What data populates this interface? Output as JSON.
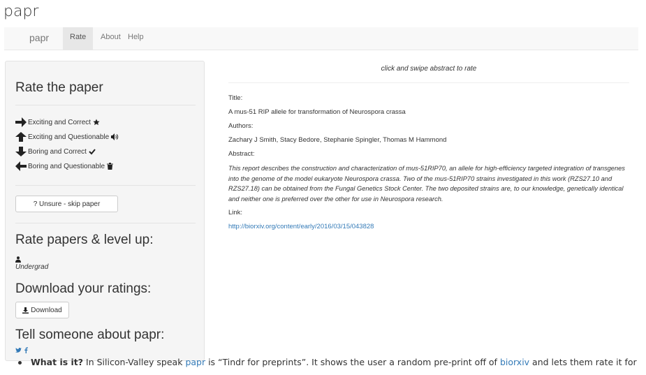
{
  "page": {
    "title": "papr"
  },
  "navbar": {
    "brand": "papr",
    "items": [
      {
        "label": "Rate",
        "active": true
      },
      {
        "label": "About",
        "active": false
      },
      {
        "label": "Help",
        "active": false
      }
    ]
  },
  "sidebar": {
    "heading_rate": "Rate the paper",
    "rate_options": [
      {
        "direction": "right",
        "label": "Exciting and Correct",
        "icon": "star-icon"
      },
      {
        "direction": "up",
        "label": "Exciting and Questionable",
        "icon": "volume-icon"
      },
      {
        "direction": "down",
        "label": "Boring and Correct",
        "icon": "check-icon"
      },
      {
        "direction": "left",
        "label": "Boring and Questionable",
        "icon": "trash-icon"
      }
    ],
    "skip_button": "? Unsure - skip paper",
    "heading_level": "Rate papers & level up:",
    "level_name": "Undergrad",
    "heading_download": "Download your ratings:",
    "download_button": "Download",
    "heading_share": "Tell someone about papr:",
    "share_icons": [
      "twitter-icon",
      "facebook-icon"
    ]
  },
  "main": {
    "instruction": "click and swipe abstract to rate",
    "title_label": "Title:",
    "title": "A mus-51 RIP allele for transformation of Neurospora crassa",
    "authors_label": "Authors:",
    "authors": "Zachary J Smith, Stacy Bedore, Stephanie Spingler, Thomas M Hammond",
    "abstract_label": "Abstract:",
    "abstract": "This report describes the construction and characterization of mus-51RIP70, an allele for high-efficiency targeted integration of transgenes into the genome of the model eukaryote Neurospora crassa. Two of the mus-51RIP70 strains investigated in this work (RZS27.10 and RZS27.18) can be obtained from the Fungal Genetics Stock Center. The two deposited strains are, to our knowledge, genetically identical and neither one is preferred over the other for use in Neurospora research.",
    "link_label": "Link:",
    "link": "http://biorxiv.org/content/early/2016/03/15/043828"
  },
  "bullet": {
    "bold": "What is it?",
    "t1": " In Silicon-Valley speak ",
    "l1": "papr",
    "t2": " is “Tindr for preprints”. It shows the user a random pre-print off of ",
    "l2": "biorxiv",
    "t3": " and lets them rate it for"
  },
  "colors": {
    "link": "#337ab7",
    "panel": "#f5f5f5",
    "navbar": "#f8f8f8"
  }
}
